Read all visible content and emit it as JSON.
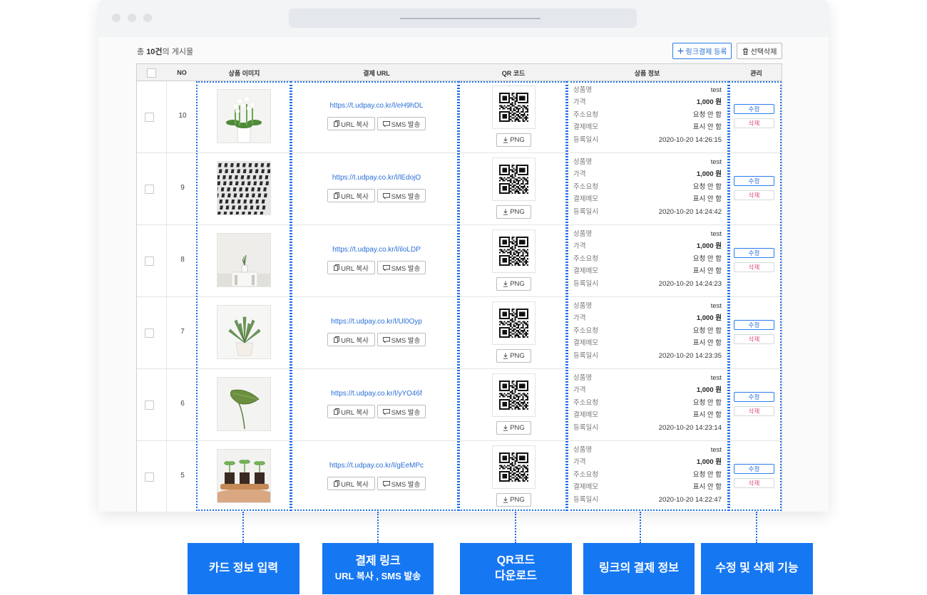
{
  "toolbar": {
    "total_prefix": "총 ",
    "total_count": "10건",
    "total_suffix": "의 게시물",
    "register_label": "링크결제 등록",
    "delete_selected_label": "선택삭제"
  },
  "table": {
    "headers": [
      "NO",
      "상품 이미지",
      "결제 URL",
      "QR 코드",
      "상품 정보",
      "관리"
    ],
    "info_keys": [
      "상품명",
      "가격",
      "주소요청",
      "결제메모",
      "등록일시"
    ],
    "copy_label": "URL 복사",
    "sms_label": "SMS 발송",
    "png_label": "PNG",
    "edit_label": "수정",
    "delete_label": "삭제",
    "rows": [
      {
        "no": "10",
        "url": "https://t.udpay.co.kr/l/eH9hDL",
        "name": "test",
        "price": "1,000 원",
        "address": "요청 안 함",
        "memo": "표시 안 함",
        "date": "2020-10-20 14:26:15",
        "image": "white-flowers"
      },
      {
        "no": "9",
        "url": "https://t.udpay.co.kr/l/lEdojO",
        "name": "test",
        "price": "1,000 원",
        "address": "요청 안 함",
        "memo": "표시 안 함",
        "date": "2020-10-20 14:24:42",
        "image": "building-facade"
      },
      {
        "no": "8",
        "url": "https://t.udpay.co.kr/l/iloLDP",
        "name": "test",
        "price": "1,000 원",
        "address": "요청 안 함",
        "memo": "표시 안 함",
        "date": "2020-10-20 14:24:23",
        "image": "small-vase"
      },
      {
        "no": "7",
        "url": "https://t.udpay.co.kr/l/Ul0Oyp",
        "name": "test",
        "price": "1,000 원",
        "address": "요청 안 함",
        "memo": "표시 안 함",
        "date": "2020-10-20 14:23:35",
        "image": "aloe-pot"
      },
      {
        "no": "6",
        "url": "https://t.udpay.co.kr/l/yYO46f",
        "name": "test",
        "price": "1,000 원",
        "address": "요청 안 함",
        "memo": "표시 안 함",
        "date": "2020-10-20 14:23:14",
        "image": "single-leaf"
      },
      {
        "no": "5",
        "url": "https://t.udpay.co.kr/l/gEeMPc",
        "name": "test",
        "price": "1,000 원",
        "address": "요청 안 함",
        "memo": "표시 안 함",
        "date": "2020-10-20 14:22:47",
        "image": "seedlings-tray"
      }
    ]
  },
  "callouts": [
    {
      "line1": "카드 정보 입력",
      "line2": ""
    },
    {
      "line1": "결제 링크",
      "line2": "URL 복사 , SMS 발송"
    },
    {
      "line1": "QR코드",
      "line2": "다운로드"
    },
    {
      "line1": "링크의 결제 정보",
      "line2": ""
    },
    {
      "line1": "수정 및 삭제 기능",
      "line2": ""
    }
  ],
  "colors": {
    "accent": "#1677f2",
    "link": "#2b6fd6",
    "delete": "#e0507a"
  }
}
